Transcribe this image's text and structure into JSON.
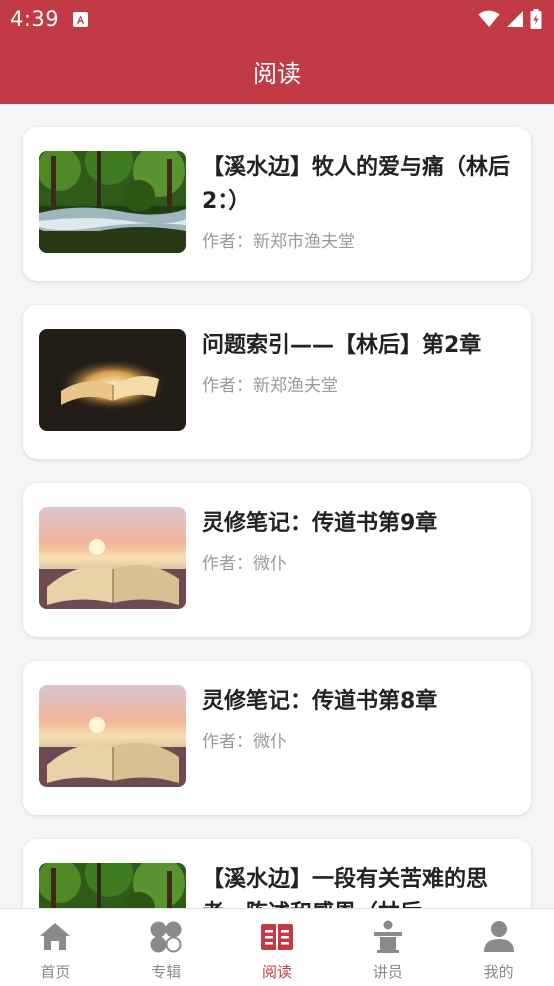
{
  "status_bar": {
    "time": "4:39"
  },
  "app_bar": {
    "title": "阅读"
  },
  "articles": [
    {
      "title": "【溪水边】牧人的爱与痛（林后2：）",
      "author": "作者：新郑市渔夫堂",
      "thumb": "forest-river"
    },
    {
      "title": "问题索引——【林后】第2章",
      "author": "作者：新郑渔夫堂",
      "thumb": "glowing-bible"
    },
    {
      "title": "灵修笔记：传道书第9章",
      "author": "作者：微仆",
      "thumb": "sunset-bible"
    },
    {
      "title": "灵修笔记：传道书第8章",
      "author": "作者：微仆",
      "thumb": "sunset-bible"
    },
    {
      "title": "【溪水边】一段有关苦难的思考、陈述和感恩（林后…",
      "author": "",
      "thumb": "forest-river"
    }
  ],
  "bottom_nav": {
    "items": [
      {
        "label": "首页",
        "icon": "home-icon",
        "active": false
      },
      {
        "label": "专辑",
        "icon": "clover-icon",
        "active": false
      },
      {
        "label": "阅读",
        "icon": "book-icon",
        "active": true
      },
      {
        "label": "讲员",
        "icon": "speaker-podium-icon",
        "active": false
      },
      {
        "label": "我的",
        "icon": "person-icon",
        "active": false
      }
    ]
  },
  "colors": {
    "brand": "#c23a46",
    "inactive": "#8a8a8a"
  }
}
